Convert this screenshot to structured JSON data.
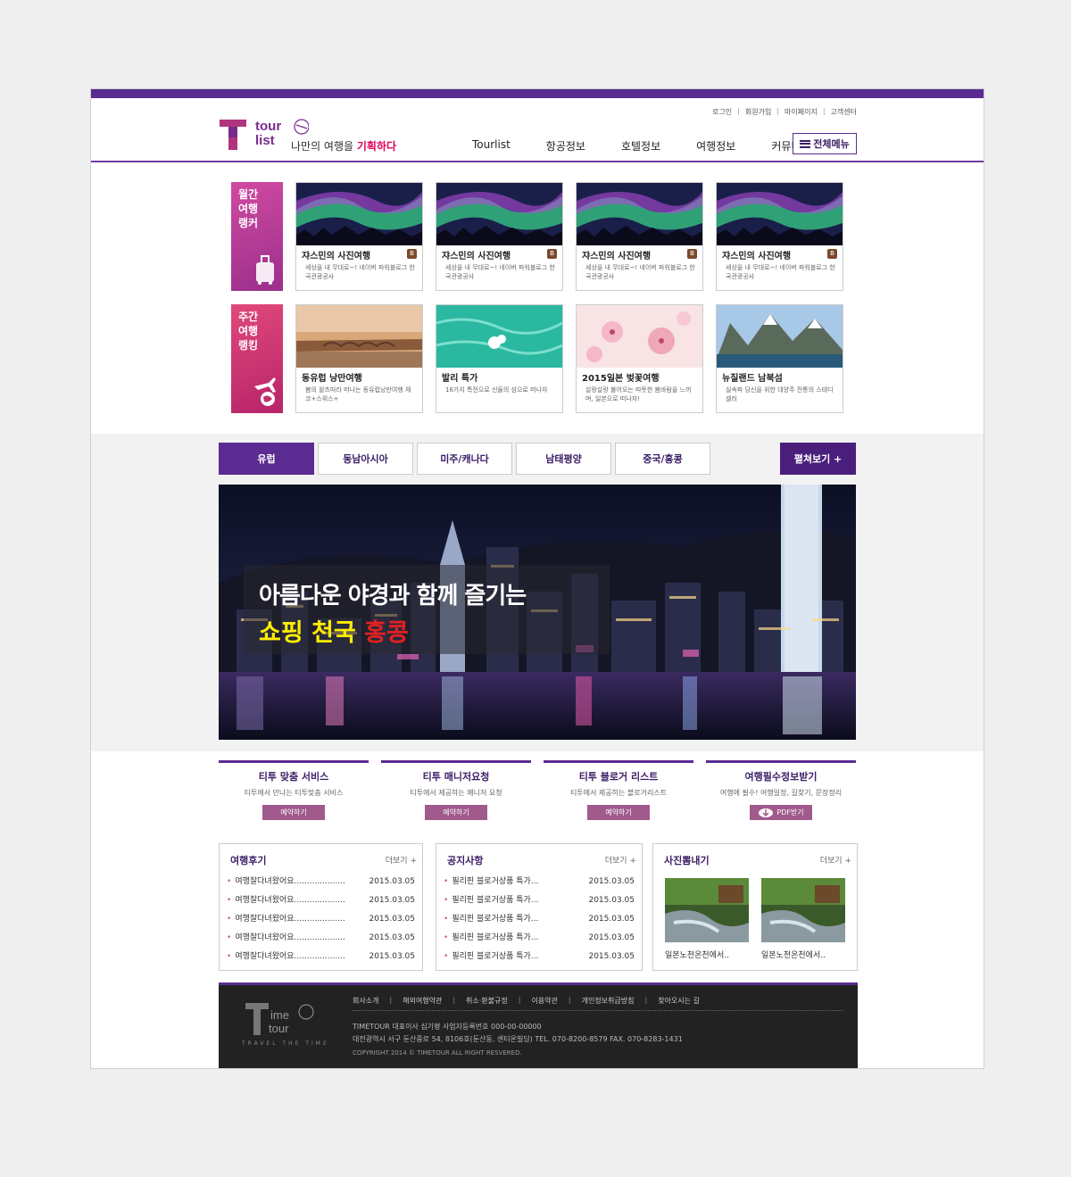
{
  "brand": {
    "logo_line1": "tour",
    "logo_line2": "list",
    "logo_t": "T",
    "slogan_pre": "나만의 여행을 ",
    "slogan_highlight": "기획하다",
    "accent": "#5a2c91",
    "highlight_color": "#e0005b"
  },
  "util_links": [
    "로그인",
    "회원가입",
    "마이페이지",
    "고객센터"
  ],
  "util_sep": "|",
  "gnb": [
    "Tourlist",
    "항공정보",
    "호텔정보",
    "여행정보",
    "커뮤니티"
  ],
  "allmenu_label": "전체메뉴",
  "monthly": {
    "label": "월간\n여행\n랭커",
    "icon": "luggage-icon",
    "cards": [
      {
        "title": "쟈스민의 사진여행",
        "desc": "세상을 내 무대로~! 네이버 파워블로그 한국관광공사",
        "badge": "B"
      },
      {
        "title": "쟈스민의 사진여행",
        "desc": "세상을 내 무대로~! 네이버 파워블로그 한국관광공사",
        "badge": "B"
      },
      {
        "title": "쟈스민의 사진여행",
        "desc": "세상을 내 무대로~! 네이버 파워블로그 한국관광공사",
        "badge": "B"
      },
      {
        "title": "쟈스민의 사진여행",
        "desc": "세상을 내 무대로~! 네이버 파워블로그 한국관광공사",
        "badge": "B"
      }
    ]
  },
  "weekly": {
    "label": "주간\n여행\n랭킹",
    "icon": "airplane-globe-icon",
    "cards": [
      {
        "title": "동유럽 낭만여행",
        "desc": "봄의 왈츠따라 떠나는 동유럽낭만여행 체코+스위스+"
      },
      {
        "title": "발리 특가",
        "desc": "16가지 특전으로 신들의 섬으로 떠나자"
      },
      {
        "title": "2015일본 벚꽃여행",
        "desc": "살랑살랑 불어오는 따뜻한 봄바람을 느끼며, 일본으로 떠나자!"
      },
      {
        "title": "뉴질랜드 남북섬",
        "desc": "실속파 당신을 위한 대양주 전통의 스테디 셀러"
      }
    ]
  },
  "region_tabs": [
    "유럽",
    "동남아시아",
    "미주/캐나다",
    "남태평양",
    "중국/홍콩"
  ],
  "expand_label": "펼쳐보기 +",
  "banner": {
    "line1": "아름다운 야경과 함께 즐기는",
    "line2_yellow": "쇼핑 천국 ",
    "line2_red": "홍콩"
  },
  "services": [
    {
      "title": "티투 맞춤 서비스",
      "desc": "티투에서 만나는 티투맞춤 서비스",
      "button": "예약하기",
      "icon": ""
    },
    {
      "title": "티투 매니저요청",
      "desc": "티투에서 제공하는 매니저 요청",
      "button": "예약하기",
      "icon": ""
    },
    {
      "title": "티투 블로거 리스트",
      "desc": "티투에서 제공하는 블로거리스트",
      "button": "예약하기",
      "icon": ""
    },
    {
      "title": "여행필수정보받기",
      "desc": "여행에 필수! 여행일정, 길찾기, 문장정리",
      "button": "PDF받기",
      "icon": "download-cloud-icon"
    }
  ],
  "reviews": {
    "title": "여행후기",
    "more": "더보기 +",
    "items": [
      {
        "text": "여행잘다녀왔어요....................",
        "date": "2015.03.05"
      },
      {
        "text": "여행잘다녀왔어요....................",
        "date": "2015.03.05"
      },
      {
        "text": "여행잘다녀왔어요....................",
        "date": "2015.03.05"
      },
      {
        "text": "여행잘다녀왔어요....................",
        "date": "2015.03.05"
      },
      {
        "text": "여행잘다녀왔어요....................",
        "date": "2015.03.05"
      }
    ]
  },
  "notices": {
    "title": "공지사항",
    "more": "더보기 +",
    "items": [
      {
        "text": "필리핀 블로거상품 특가...",
        "date": "2015.03.05"
      },
      {
        "text": "필리핀 블로거상품 특가...",
        "date": "2015.03.05"
      },
      {
        "text": "필리핀 블로거상품 특가...",
        "date": "2015.03.05"
      },
      {
        "text": "필리핀 블로거상품 특가...",
        "date": "2015.03.05"
      },
      {
        "text": "필리핀 블로거상품 특가...",
        "date": "2015.03.05"
      }
    ]
  },
  "photos": {
    "title": "사진뽐내기",
    "more": "더보기 +",
    "items": [
      {
        "caption": "일본노천온천에서.."
      },
      {
        "caption": "일본노천온천에서.."
      }
    ]
  },
  "footer": {
    "logo_line1": "ime",
    "logo_line2": "tour",
    "logo_t": "T",
    "tagline": "TRAVEL THE TIME",
    "links": [
      "회사소개",
      "해외여행약관",
      "취소·환불규정",
      "이용약관",
      "개인정보취급방침",
      "찾아오시는 길"
    ],
    "info1": "TIMETOUR  대표이사 심기평  사업자등록번호 000-00-00000",
    "info2": "대전광역시 서구 둔산중로 54, 8106호(둔산동, 센티온빌딩)   TEL. 070-8200-8579   FAX. 070-8283-1431",
    "copyright": "COPYRIGHT 2014 © TIMETOUR ALL RIGHT RESVERED."
  }
}
